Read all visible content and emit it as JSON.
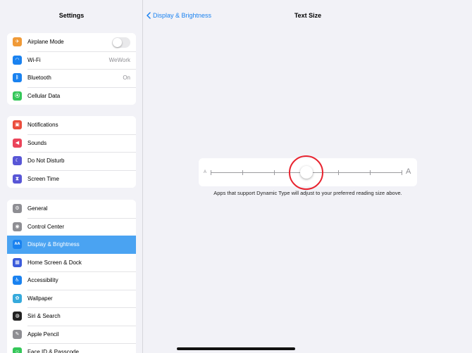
{
  "sidebar": {
    "title": "Settings",
    "groups": [
      {
        "items": [
          {
            "label": "Airplane Mode",
            "icon": "airplane-icon",
            "color": "#f09a37",
            "glyph": "✈",
            "control": "toggle",
            "toggle_on": false
          },
          {
            "label": "Wi-Fi",
            "icon": "wifi-icon",
            "color": "#1a82f0",
            "glyph": "◠",
            "value": "WeWork"
          },
          {
            "label": "Bluetooth",
            "icon": "bluetooth-icon",
            "color": "#1a82f0",
            "glyph": "ᛒ",
            "value": "On"
          },
          {
            "label": "Cellular Data",
            "icon": "cellular-icon",
            "color": "#34c759",
            "glyph": "⦿"
          }
        ]
      },
      {
        "items": [
          {
            "label": "Notifications",
            "icon": "notifications-icon",
            "color": "#eb4d3d",
            "glyph": "▣"
          },
          {
            "label": "Sounds",
            "icon": "sounds-icon",
            "color": "#eb445a",
            "glyph": "◀"
          },
          {
            "label": "Do Not Disturb",
            "icon": "moon-icon",
            "color": "#5856d6",
            "glyph": "☾"
          },
          {
            "label": "Screen Time",
            "icon": "hourglass-icon",
            "color": "#5856d6",
            "glyph": "⧗"
          }
        ]
      },
      {
        "items": [
          {
            "label": "General",
            "icon": "gear-icon",
            "color": "#8e8e93",
            "glyph": "⚙"
          },
          {
            "label": "Control Center",
            "icon": "control-center-icon",
            "color": "#8e8e93",
            "glyph": "◉"
          },
          {
            "label": "Display & Brightness",
            "icon": "display-icon",
            "color": "#1a82f0",
            "glyph": "AA",
            "selected": true
          },
          {
            "label": "Home Screen & Dock",
            "icon": "home-screen-icon",
            "color": "#3b5bdb",
            "glyph": "▦"
          },
          {
            "label": "Accessibility",
            "icon": "accessibility-icon",
            "color": "#1a82f0",
            "glyph": "♿"
          },
          {
            "label": "Wallpaper",
            "icon": "wallpaper-icon",
            "color": "#36aadc",
            "glyph": "✿"
          },
          {
            "label": "Siri & Search",
            "icon": "siri-icon",
            "color": "#222222",
            "glyph": "◍"
          },
          {
            "label": "Apple Pencil",
            "icon": "pencil-icon",
            "color": "#8e8e93",
            "glyph": "✎"
          },
          {
            "label": "Face ID & Passcode",
            "icon": "face-id-icon",
            "color": "#34c759",
            "glyph": "☺"
          }
        ]
      }
    ]
  },
  "nav": {
    "back_label": "Display & Brightness",
    "title": "Text Size"
  },
  "slider": {
    "small_label": "A",
    "large_label": "A",
    "steps": 7,
    "selected_step": 3
  },
  "caption": "Apps that support Dynamic Type will adjust to your preferred reading size above.",
  "colors": {
    "accent": "#1a82f0",
    "selected_row": "#4aa3f2",
    "highlight_ring": "#e8232f"
  }
}
